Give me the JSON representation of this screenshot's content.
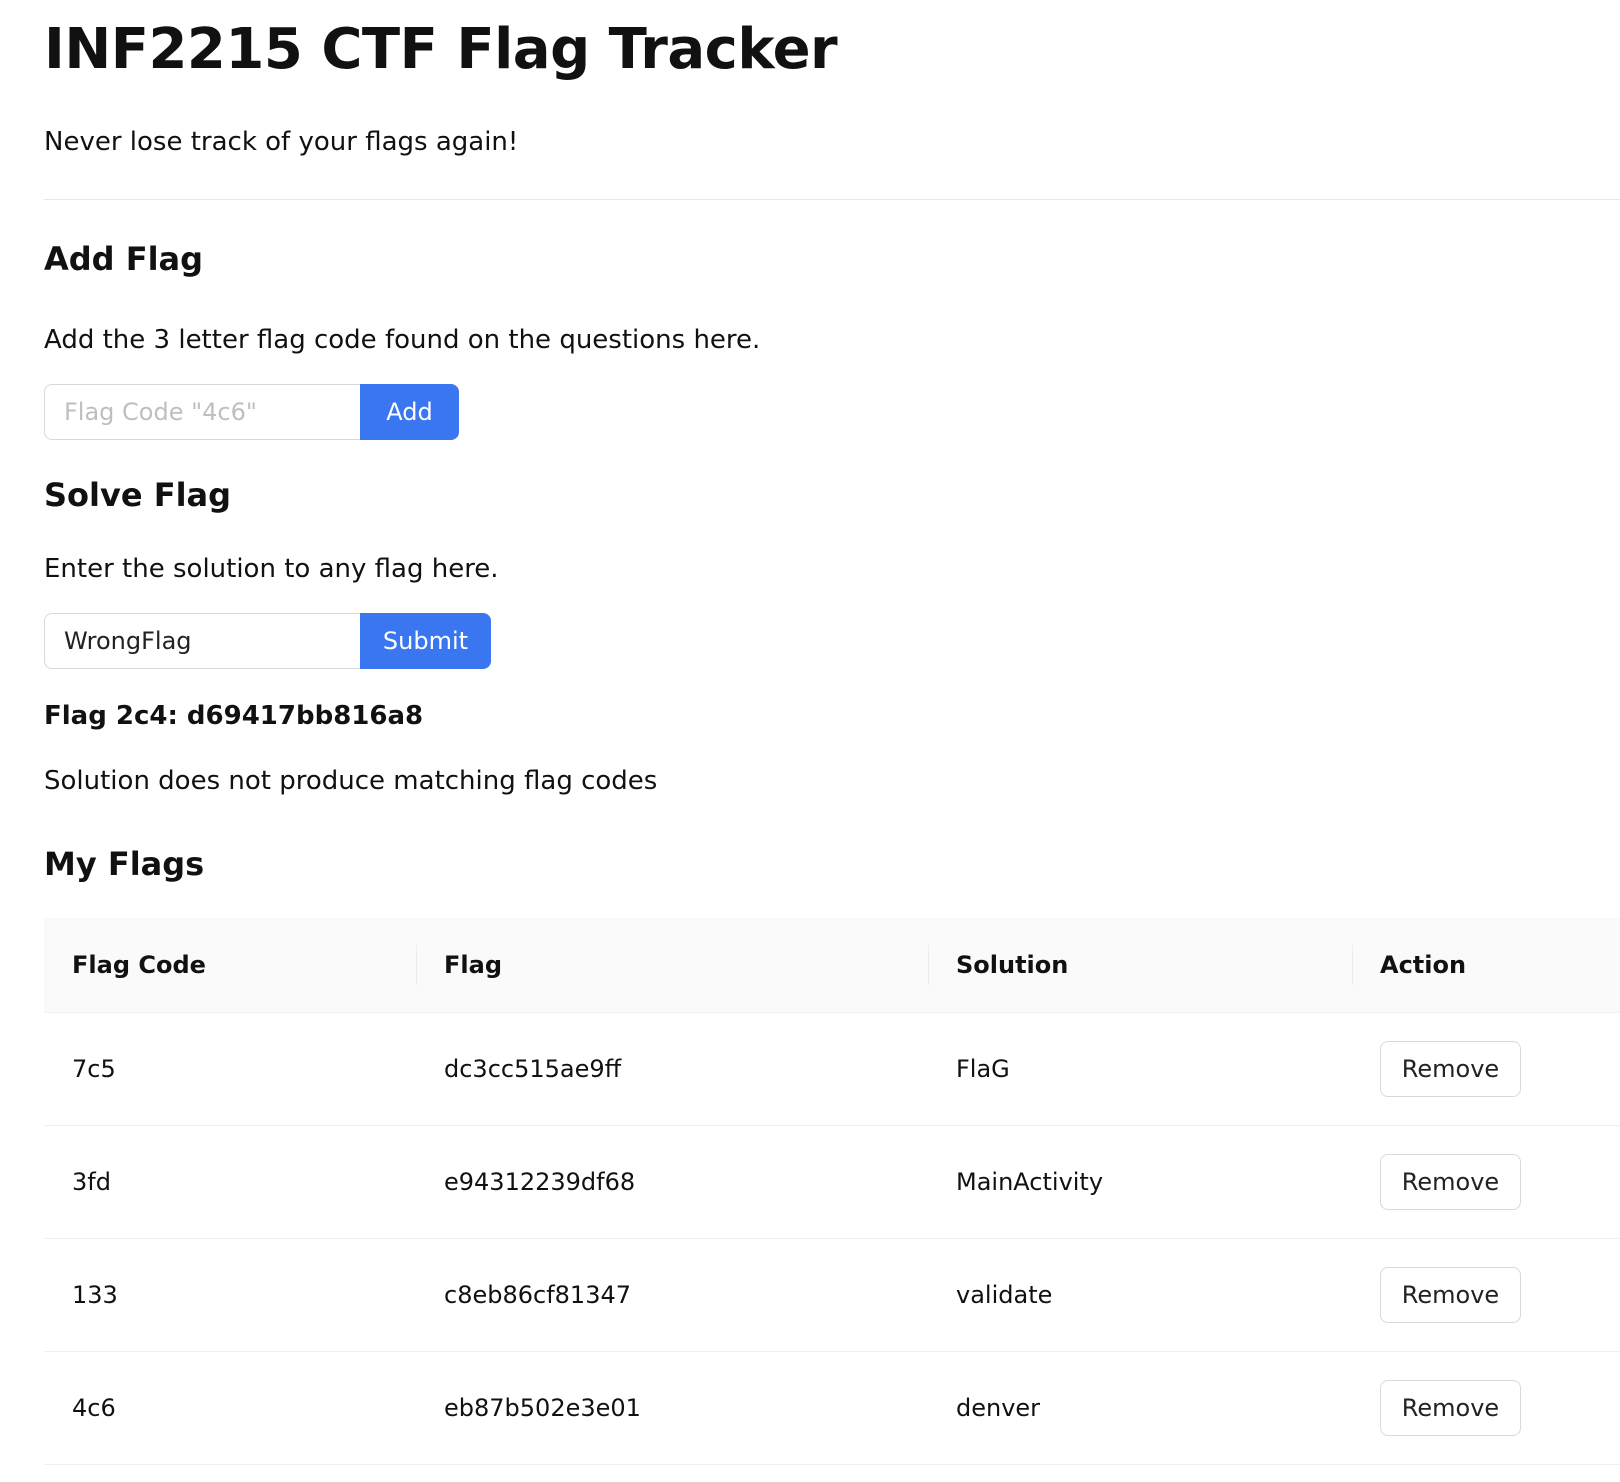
{
  "header": {
    "title": "INF2215 CTF Flag Tracker",
    "tagline": "Never lose track of your flags again!"
  },
  "add_flag": {
    "heading": "Add Flag",
    "description": "Add the 3 letter flag code found on the questions here.",
    "input_value": "",
    "input_placeholder": "Flag Code \"4c6\"",
    "button_label": "Add"
  },
  "solve_flag": {
    "heading": "Solve Flag",
    "description": "Enter the solution to any flag here.",
    "input_value": "WrongFlag",
    "input_placeholder": "",
    "button_label": "Submit",
    "result": "Flag 2c4: d69417bb816a8",
    "message": "Solution does not produce matching flag codes"
  },
  "my_flags": {
    "heading": "My Flags",
    "columns": [
      "Flag Code",
      "Flag",
      "Solution",
      "Action"
    ],
    "rows": [
      {
        "code": "7c5",
        "flag": "dc3cc515ae9ff",
        "solution": "FlaG",
        "action": "Remove"
      },
      {
        "code": "3fd",
        "flag": "e94312239df68",
        "solution": "MainActivity",
        "action": "Remove"
      },
      {
        "code": "133",
        "flag": "c8eb86cf81347",
        "solution": "validate",
        "action": "Remove"
      },
      {
        "code": "4c6",
        "flag": "eb87b502e3e01",
        "solution": "denver",
        "action": "Remove"
      }
    ]
  }
}
